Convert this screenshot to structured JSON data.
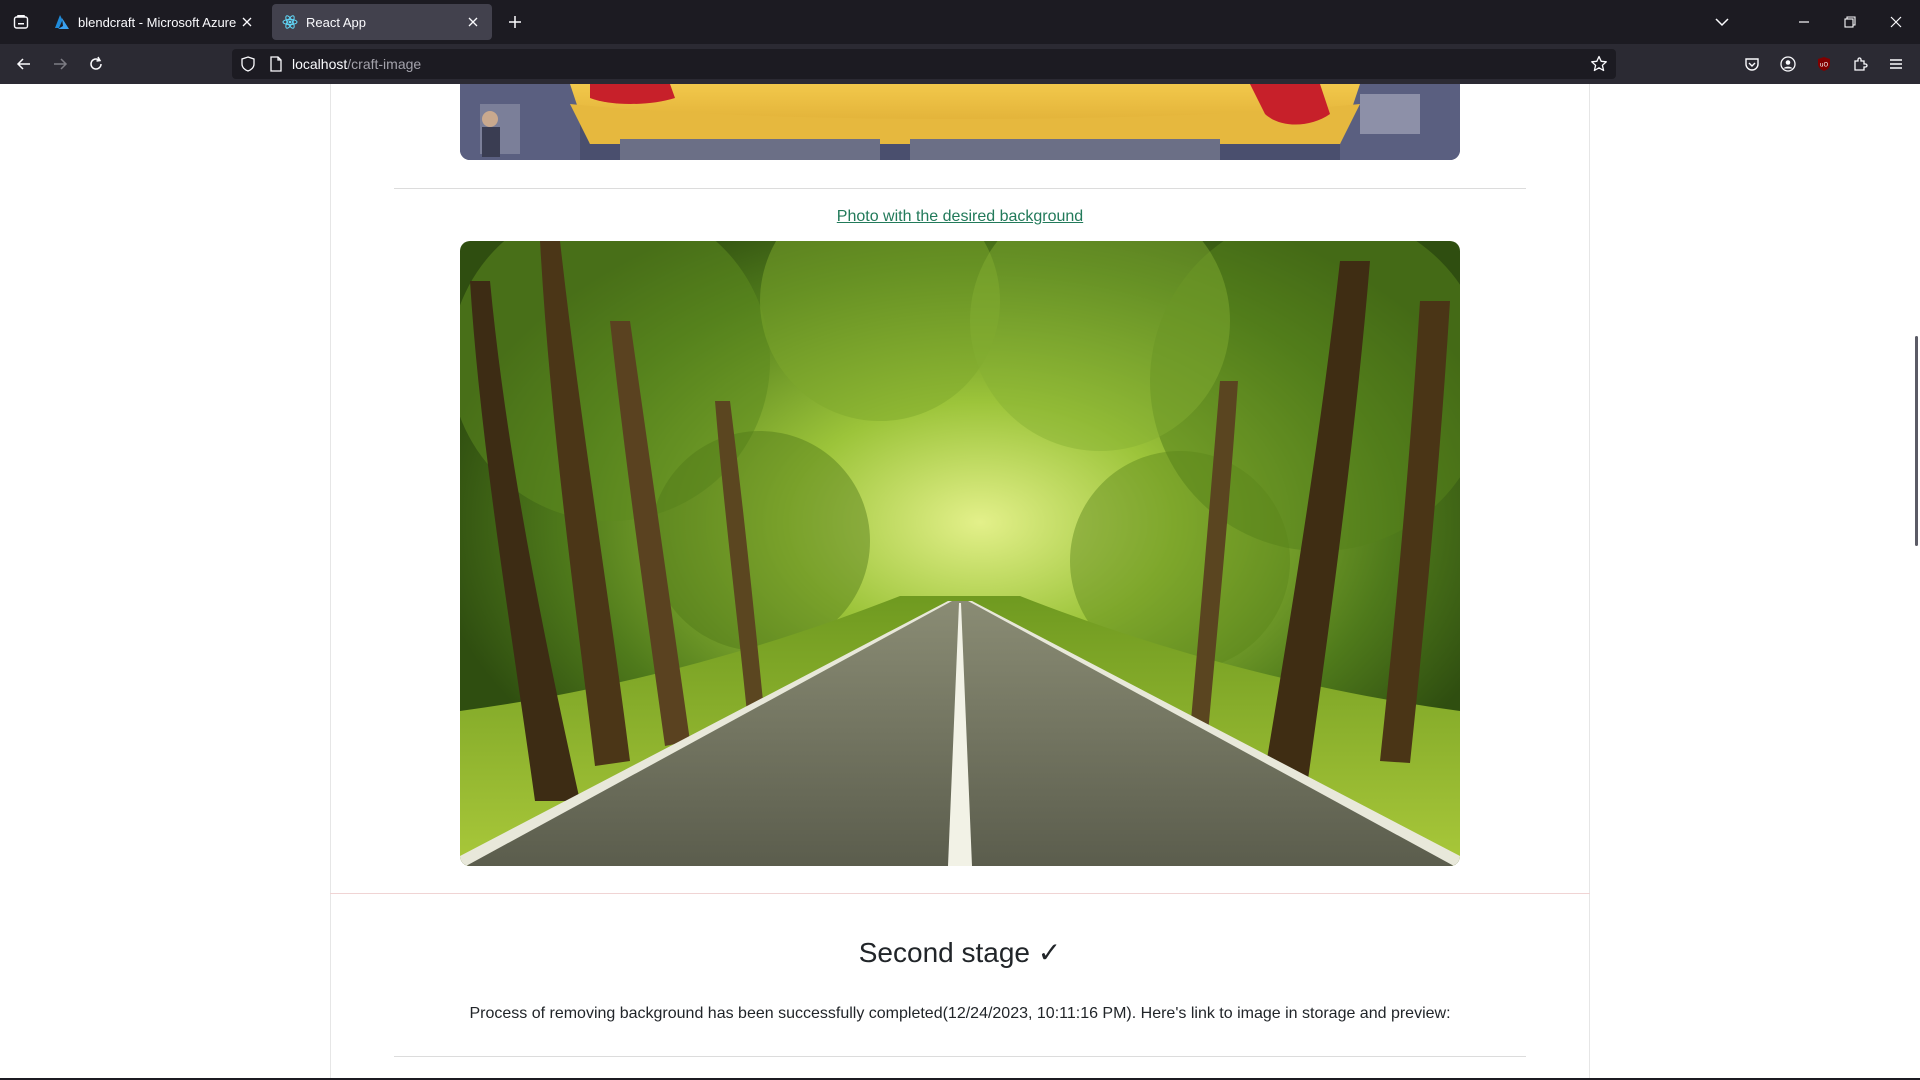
{
  "browser": {
    "tabs": [
      {
        "title": "blendcraft - Microsoft Azure",
        "active": false
      },
      {
        "title": "React App",
        "active": true
      }
    ],
    "url": {
      "host": "localhost",
      "path": "/craft-image"
    }
  },
  "page": {
    "background_link": "Photo with the desired background",
    "stage_title": "Second stage ✓",
    "stage_text": "Process of removing background has been successfully completed(12/24/2023, 10:11:16 PM). Here's link to image in storage and preview:"
  },
  "colors": {
    "link": "#227a5a",
    "chrome_dark": "#1c1b22",
    "chrome_bar": "#2b2a33",
    "active_tab": "#42414d"
  }
}
